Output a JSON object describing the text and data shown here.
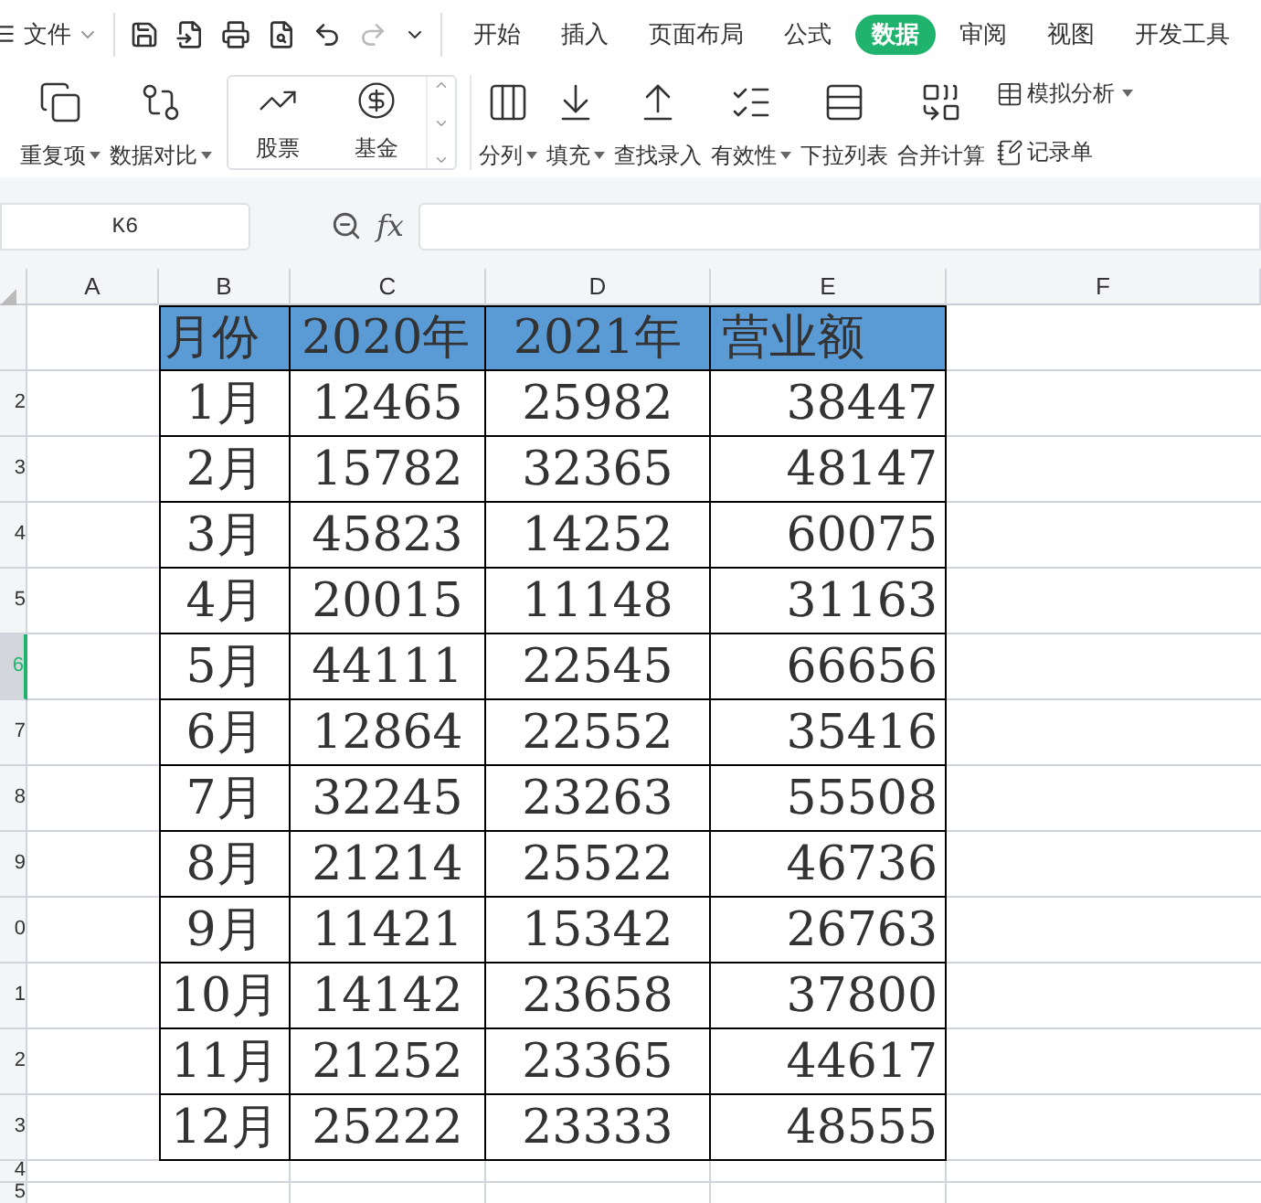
{
  "menu": {
    "label": "文件"
  },
  "tabs": [
    {
      "label": "开始",
      "selected": false
    },
    {
      "label": "插入",
      "selected": false
    },
    {
      "label": "页面布局",
      "selected": false
    },
    {
      "label": "公式",
      "selected": false
    },
    {
      "label": "数据",
      "selected": true
    },
    {
      "label": "审阅",
      "selected": false
    },
    {
      "label": "视图",
      "selected": false
    },
    {
      "label": "开发工具",
      "selected": false
    }
  ],
  "ribbon": [
    {
      "kind": "large",
      "label": "重复项",
      "dropdown": true
    },
    {
      "kind": "large",
      "label": "数据对比",
      "dropdown": true
    },
    {
      "kind": "gallery",
      "items": [
        "股票",
        "基金"
      ]
    },
    {
      "kind": "large",
      "label": "分列",
      "dropdown": true
    },
    {
      "kind": "large",
      "label": "填充",
      "dropdown": true
    },
    {
      "kind": "large",
      "label": "查找录入",
      "dropdown": false
    },
    {
      "kind": "large",
      "label": "有效性",
      "dropdown": true
    },
    {
      "kind": "large",
      "label": "下拉列表",
      "dropdown": false
    },
    {
      "kind": "large",
      "label": "合并计算",
      "dropdown": false
    },
    {
      "kind": "small",
      "items": [
        {
          "label": "模拟分析",
          "dropdown": true
        },
        {
          "label": "记录单",
          "dropdown": false
        }
      ]
    }
  ],
  "formula_bar": {
    "name_box": "K6",
    "fx": "fx"
  },
  "columns": [
    "A",
    "B",
    "C",
    "D",
    "E",
    "F"
  ],
  "row_headers": [
    {
      "selected": false
    },
    {
      "label": "2",
      "selected": false
    },
    {
      "label": "3",
      "selected": false
    },
    {
      "label": "4",
      "selected": false
    },
    {
      "label": "5",
      "selected": false
    },
    {
      "label": "6",
      "selected": true
    },
    {
      "label": "7",
      "selected": false
    },
    {
      "label": "8",
      "selected": false
    },
    {
      "label": "9",
      "selected": false
    },
    {
      "label": "0",
      "selected": false
    },
    {
      "label": "1",
      "selected": false
    },
    {
      "label": "2",
      "selected": false
    },
    {
      "label": "3",
      "selected": false
    },
    {
      "label": "4",
      "selected": false
    },
    {
      "label": "5",
      "selected": false
    }
  ],
  "table": {
    "header": [
      "月份",
      "2020年",
      "2021年",
      "营业额"
    ],
    "rows": [
      [
        "1月",
        "12465",
        "25982",
        "38447"
      ],
      [
        "2月",
        "15782",
        "32365",
        "48147"
      ],
      [
        "3月",
        "45823",
        "14252",
        "60075"
      ],
      [
        "4月",
        "20015",
        "11148",
        "31163"
      ],
      [
        "5月",
        "44111",
        "22545",
        "66656"
      ],
      [
        "6月",
        "12864",
        "22552",
        "35416"
      ],
      [
        "7月",
        "32245",
        "23263",
        "55508"
      ],
      [
        "8月",
        "21214",
        "25522",
        "46736"
      ],
      [
        "9月",
        "11421",
        "15342",
        "26763"
      ],
      [
        "10月",
        "14142",
        "23658",
        "37800"
      ],
      [
        "11月",
        "21252",
        "23365",
        "44617"
      ],
      [
        "12月",
        "25222",
        "23333",
        "48555"
      ]
    ]
  }
}
